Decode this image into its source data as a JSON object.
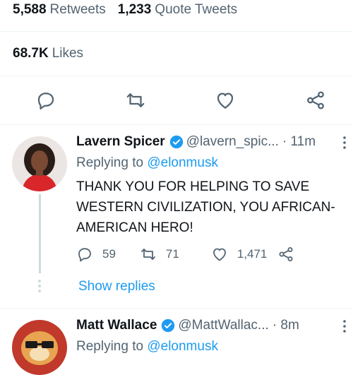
{
  "stats": {
    "retweets_count": "5,588",
    "retweets_label": "Retweets",
    "quotes_count": "1,233",
    "quotes_label": "Quote Tweets",
    "likes_count": "68.7K",
    "likes_label": "Likes"
  },
  "main_actions": {
    "icons": [
      "reply-icon",
      "retweet-icon",
      "like-icon",
      "share-icon"
    ],
    "icon_color": "#536471"
  },
  "replies": [
    {
      "name": "Lavern Spicer",
      "handle": "@lavern_spic...",
      "time": "· 11m",
      "replying_prefix": "Replying to",
      "replying_to": "@elonmusk",
      "text": "THANK YOU FOR HELPING TO SAVE WESTERN CIVILIZATION, YOU AFRICAN-AMERICAN HERO!",
      "reply_count": "59",
      "retweet_count": "71",
      "like_count": "1,471",
      "show_replies": "Show replies"
    },
    {
      "name": "Matt Wallace",
      "handle": "@MattWallac...",
      "time": "· 8m",
      "replying_prefix": "Replying to",
      "replying_to": "@elonmusk"
    }
  ],
  "colors": {
    "accent": "#1d9bf0",
    "secondary_text": "#536471",
    "divider": "#eff3f4",
    "verified_badge": "#1d9bf0"
  }
}
